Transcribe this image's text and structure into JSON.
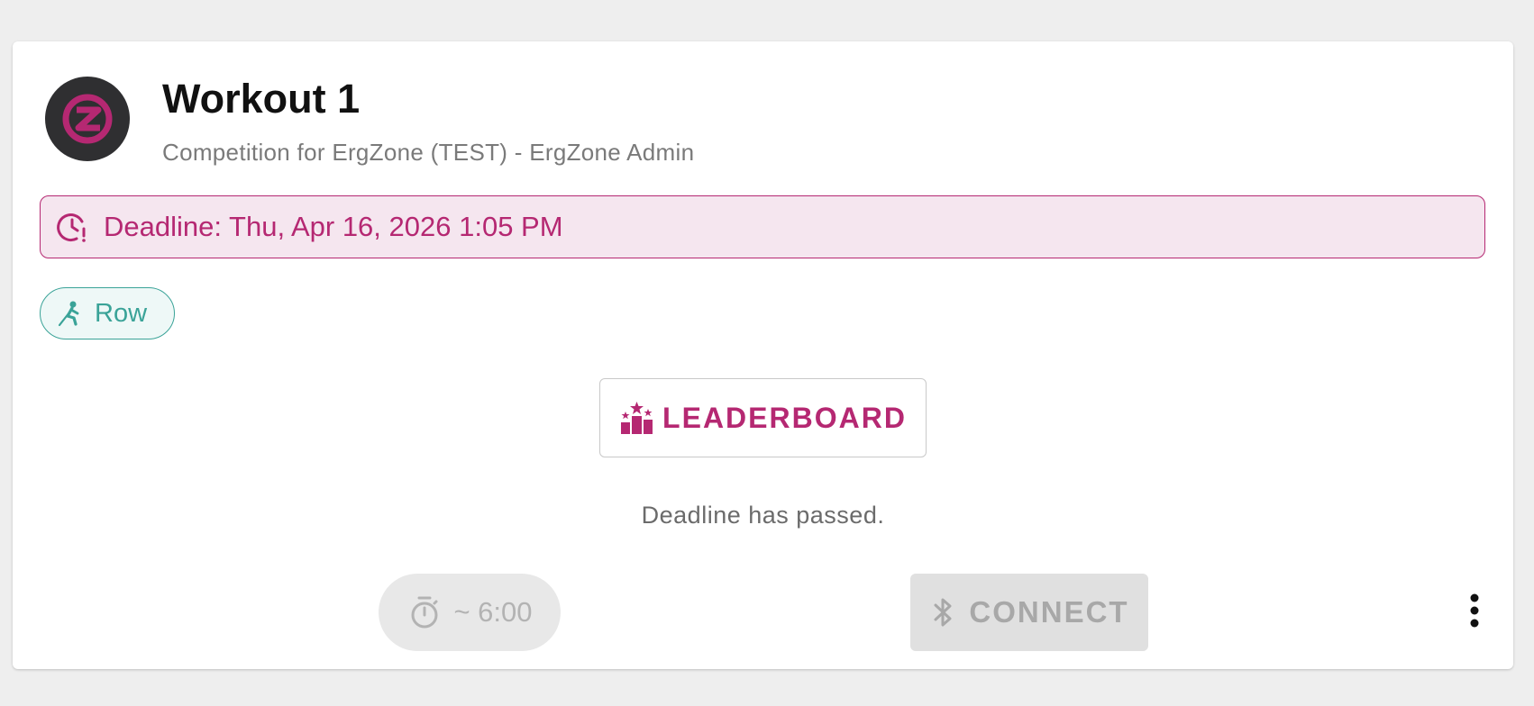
{
  "workout": {
    "title": "Workout 1",
    "subtitle": "Competition for ErgZone (TEST) - ErgZone Admin",
    "avatar_icon": "ergzone-logo-icon"
  },
  "deadline": {
    "text": "Deadline: Thu, Apr 16, 2026 1:05 PM",
    "icon": "clock-alert-icon"
  },
  "chip": {
    "label": "Row",
    "icon": "rower-icon"
  },
  "leaderboard": {
    "label": "LEADERBOARD",
    "icon": "podium-stars-icon"
  },
  "status_text": "Deadline has passed.",
  "timer": {
    "label": "~ 6:00",
    "icon": "stopwatch-icon"
  },
  "connect": {
    "label": "CONNECT",
    "icon": "bluetooth-icon"
  },
  "more_icon": "more-vertical-icon",
  "colors": {
    "brand": "#b52872",
    "banner_bg": "#f5e6ef",
    "chip": "#3aa398",
    "chip_bg": "#eef8f7",
    "disabled_bg": "#e0e0e0",
    "disabled_text": "#a8a8a8"
  }
}
